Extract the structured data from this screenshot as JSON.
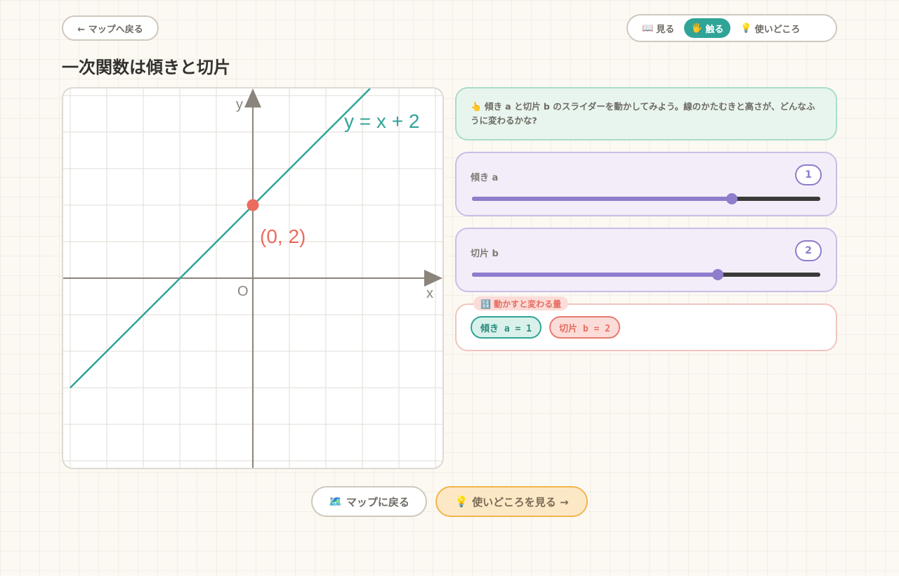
{
  "nav": {
    "back_label": "← マップへ戻る"
  },
  "tabs": [
    {
      "icon": "📖",
      "icon_name": "book-icon",
      "label": "見る"
    },
    {
      "icon": "🖐",
      "icon_name": "hand-icon",
      "label": "触る",
      "active": true
    },
    {
      "icon": "💡",
      "icon_name": "lightbulb-icon",
      "label": "使いどころ"
    }
  ],
  "title": "一次関数は傾きと切片",
  "graph": {
    "x_axis_label": "x",
    "y_axis_label": "y",
    "origin_label": "O",
    "equation_label": "y = x + 2",
    "point_label": "(0, 2)",
    "line_color": "#2fa497",
    "point_color": "#ec6b5e"
  },
  "hint": {
    "icon": "👆",
    "icon_name": "pointing-hand-icon",
    "text": "傾き a と切片 b のスライダーを動かしてみよう。線のかたむきと高さが、どんなふうに変わるかな?"
  },
  "sliders": {
    "a": {
      "label": "傾き a",
      "value": "1",
      "fraction": 0.745
    },
    "b": {
      "label": "切片 b",
      "value": "2",
      "fraction": 0.705
    }
  },
  "quantities": {
    "label": "🔢 動かすと変わる量",
    "a_chip": "傾き a = 1",
    "b_chip": "切片 b = 2"
  },
  "bottom": {
    "map_icon": "🗺️",
    "map_icon_name": "map-icon",
    "map_label": "マップに戻る",
    "uses_icon": "💡",
    "uses_icon_name": "lightbulb-icon",
    "uses_label": "使いどころを見る →"
  },
  "colors": {
    "accent": "#2fa497",
    "slider": "#8f7ccc",
    "point": "#ec6b5e"
  }
}
